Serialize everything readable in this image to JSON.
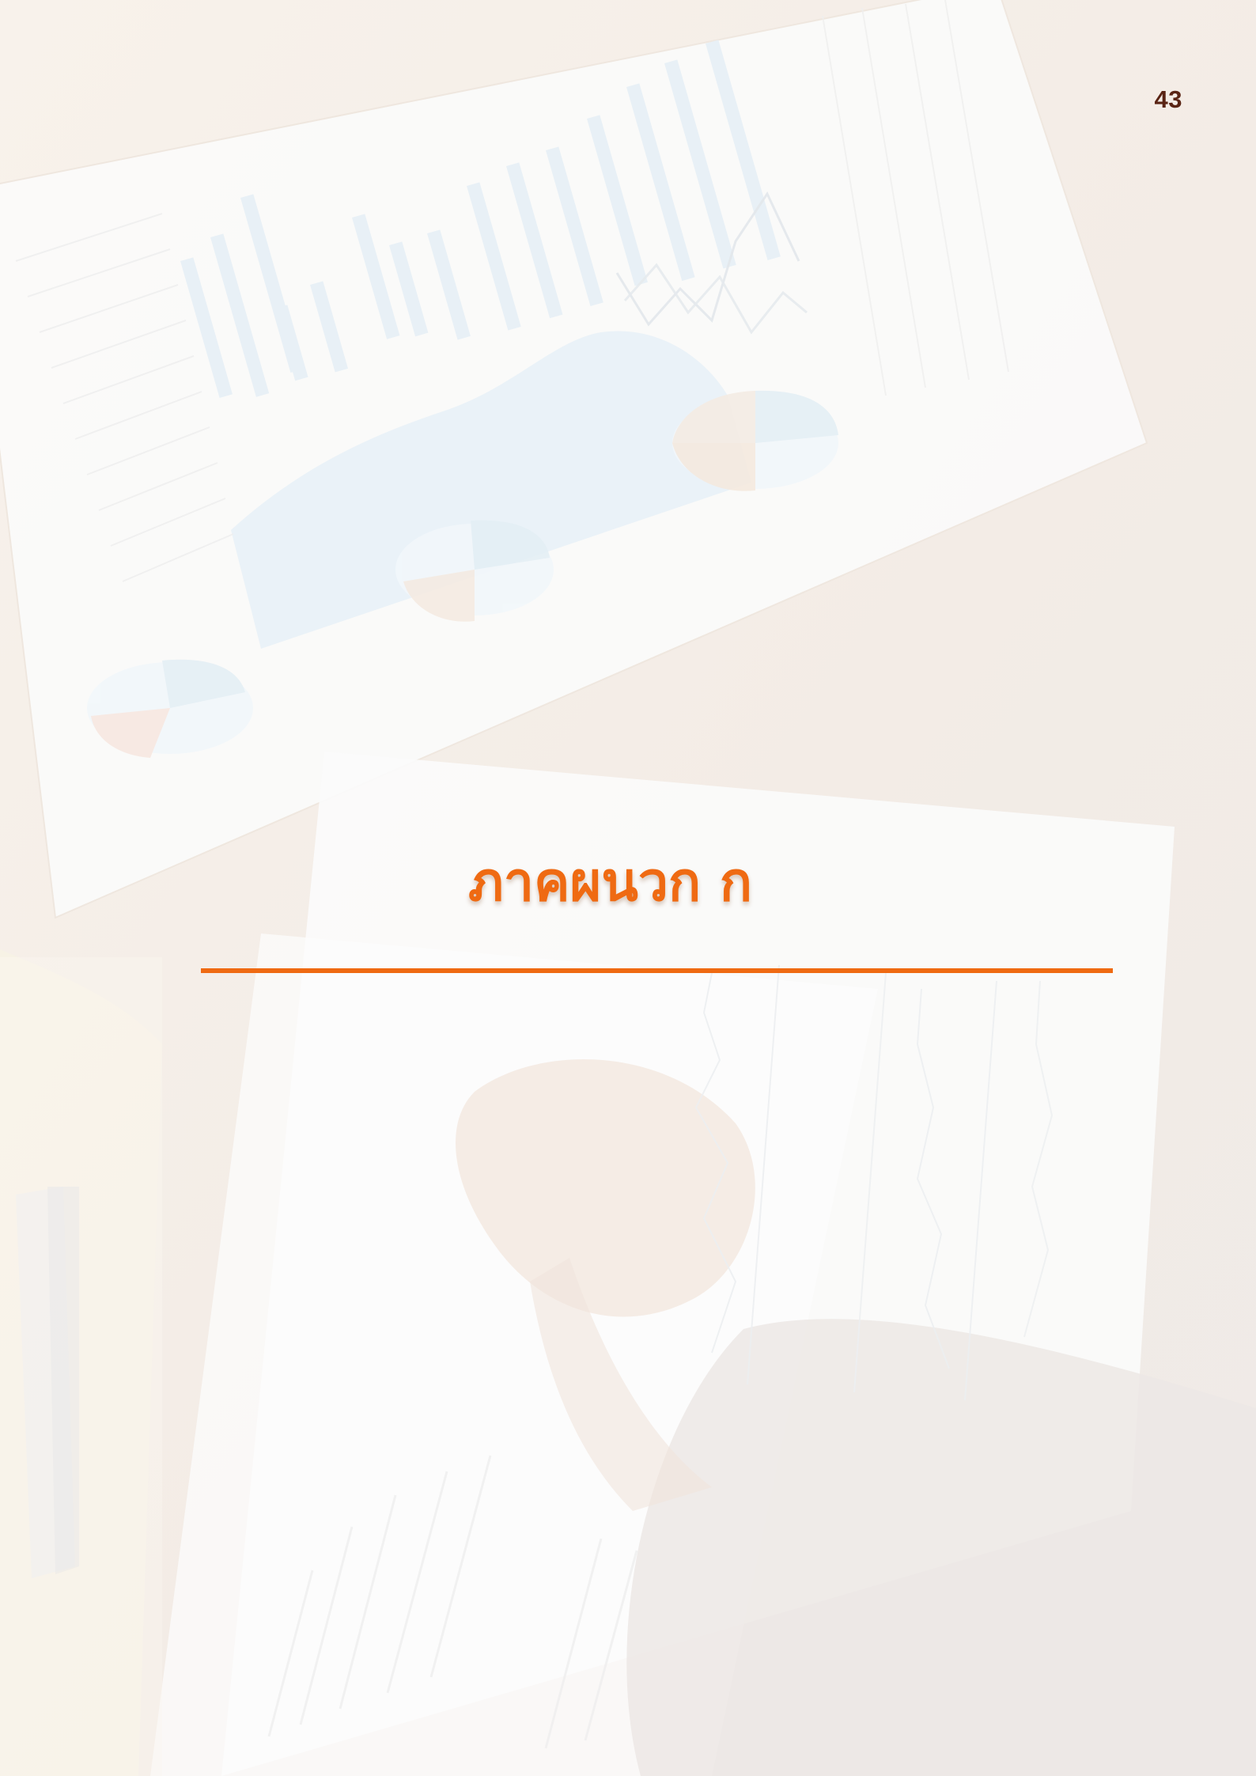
{
  "page": {
    "number": "43",
    "section_title": "ภาคผนวก ก"
  },
  "background": {
    "description_icon": "business-charts-photo-icon",
    "accent_color": "#ef6a12",
    "page_number_color": "#5a2414"
  }
}
